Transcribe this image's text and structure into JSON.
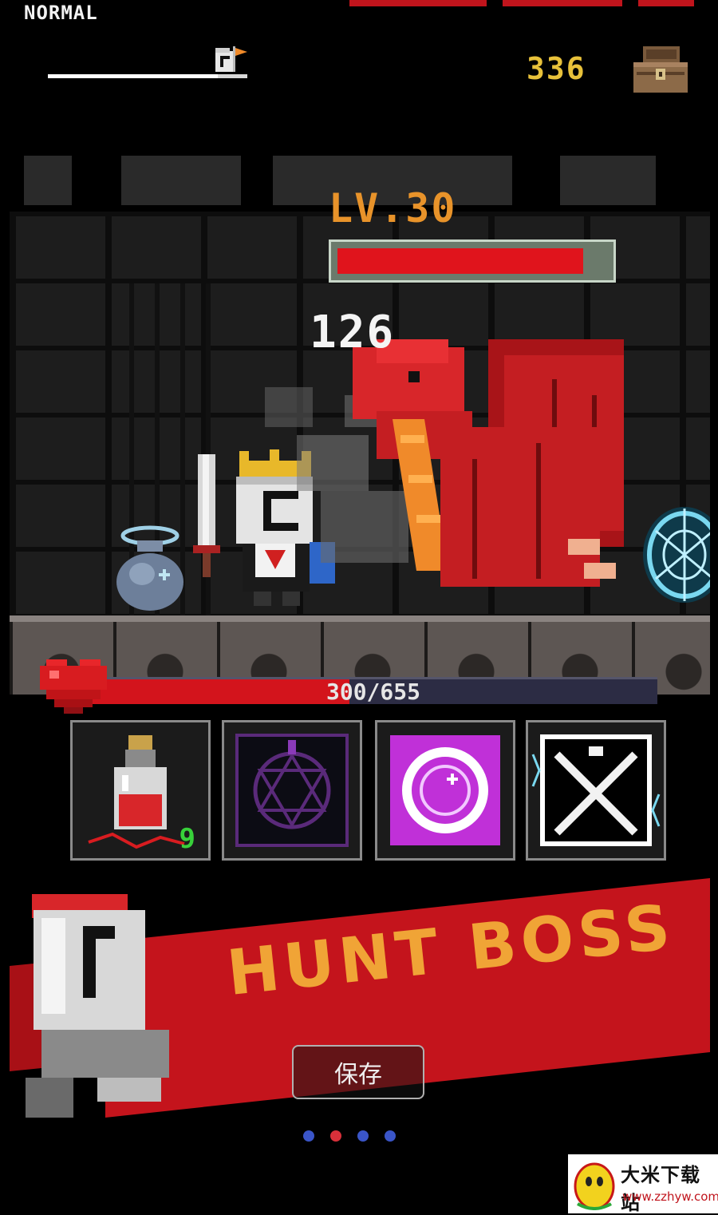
{
  "hud": {
    "difficulty": "NORMAL",
    "stage_progress": 0.85,
    "gold": "336"
  },
  "boss": {
    "level_label": "LV.30",
    "hp_fraction": 0.91,
    "damage": "126"
  },
  "player": {
    "hp_text": "300/655",
    "hp_fraction": 0.458
  },
  "skills": [
    {
      "name": "health-potion",
      "count": "9"
    },
    {
      "name": "dark-summon"
    },
    {
      "name": "magic-orb"
    },
    {
      "name": "crossed-swords"
    }
  ],
  "banner": {
    "title": "HUNT BOSS",
    "save_label": "保存"
  },
  "carousel": {
    "pages": 4,
    "active_index": 1
  },
  "watermark": {
    "name": "大米下载站",
    "url": "www.zzhyw.com"
  },
  "colors": {
    "boss_hp": "#e0141c",
    "player_hp": "#d3141c",
    "gold_text": "#e8c13a",
    "level_text": "#e8932a",
    "banner_red": "#c4141c",
    "banner_title": "#f0a436"
  }
}
